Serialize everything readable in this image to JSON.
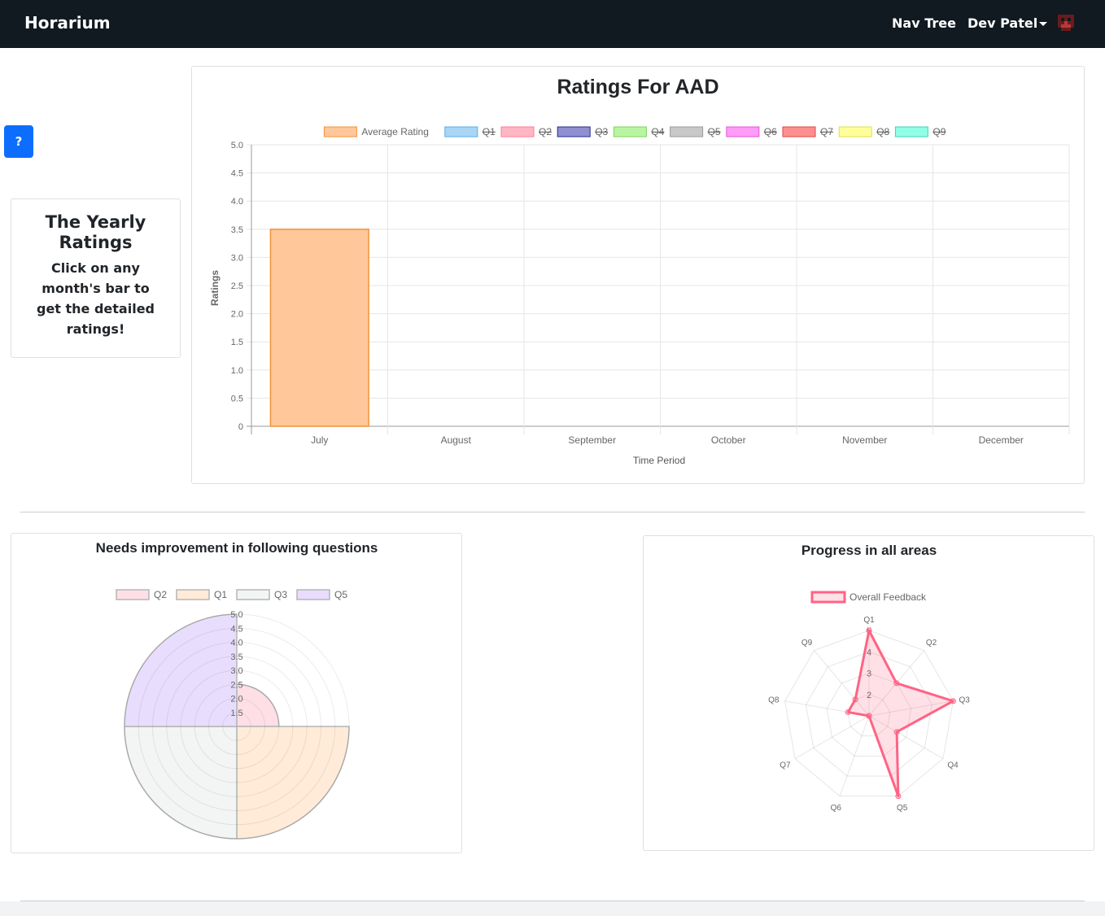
{
  "app": {
    "brand": "Horarium"
  },
  "nav": {
    "nav_tree": "Nav Tree",
    "user_name": "Dev Patel"
  },
  "help_button": "?",
  "yearly": {
    "title": "The Yearly Ratings",
    "text": "Click on any month's bar to get the detailed ratings!"
  },
  "bar_chart": {
    "title": "Ratings For AAD",
    "legend": [
      {
        "label": "Average Rating",
        "color": "#ffc79a",
        "border": "#f0933a",
        "hidden": false
      },
      {
        "label": "Q1",
        "color": "#a9d6f7",
        "border": "#5aa9e6",
        "hidden": true
      },
      {
        "label": "Q2",
        "color": "#ffb6c5",
        "border": "#ff7c98",
        "hidden": true
      },
      {
        "label": "Q3",
        "color": "#8f8fd1",
        "border": "#2b2b8e",
        "hidden": true
      },
      {
        "label": "Q4",
        "color": "#b8f5a1",
        "border": "#7cd35a",
        "hidden": true
      },
      {
        "label": "Q5",
        "color": "#c8c8c8",
        "border": "#9a9a9a",
        "hidden": true
      },
      {
        "label": "Q6",
        "color": "#ff9cf7",
        "border": "#e255d8",
        "hidden": true
      },
      {
        "label": "Q7",
        "color": "#ff8f8f",
        "border": "#e04545",
        "hidden": true
      },
      {
        "label": "Q8",
        "color": "#ffff9a",
        "border": "#dede55",
        "hidden": true
      },
      {
        "label": "Q9",
        "color": "#8fffe6",
        "border": "#3ed6b3",
        "hidden": true
      }
    ]
  },
  "polar": {
    "title": "Needs improvement in following questions",
    "legend": [
      {
        "label": "Q2",
        "color": "#ffdfe6"
      },
      {
        "label": "Q1",
        "color": "#ffebd8"
      },
      {
        "label": "Q3",
        "color": "#f3f4f4"
      },
      {
        "label": "Q5",
        "color": "#e9ddfd"
      }
    ]
  },
  "radar": {
    "title": "Progress in all areas",
    "legend": [
      {
        "label": "Overall Feedback",
        "color": "#ff6384"
      }
    ]
  },
  "chart_data": [
    {
      "type": "bar",
      "title": "Ratings For AAD",
      "xlabel": "Time Period",
      "ylabel": "Ratings",
      "categories": [
        "July",
        "August",
        "September",
        "October",
        "November",
        "December"
      ],
      "series": [
        {
          "name": "Average Rating",
          "values": [
            3.5,
            null,
            null,
            null,
            null,
            null
          ]
        }
      ],
      "ylim": [
        0,
        5
      ],
      "yticks": [
        "0",
        "0.5",
        "1.0",
        "1.5",
        "2.0",
        "2.5",
        "3.0",
        "3.5",
        "4.0",
        "4.5",
        "5.0"
      ],
      "grid": true,
      "legend_position": "top"
    },
    {
      "type": "polar-area",
      "title": "Needs improvement in following questions",
      "categories": [
        "Q2",
        "Q1",
        "Q3",
        "Q5"
      ],
      "values": [
        2.5,
        5,
        5,
        5
      ],
      "rlim": [
        1,
        5
      ],
      "rticks": [
        "1.5",
        "2.0",
        "2.5",
        "3.0",
        "3.5",
        "4.0",
        "4.5",
        "5.0"
      ],
      "legend_position": "top"
    },
    {
      "type": "radar",
      "title": "Progress in all areas",
      "categories": [
        "Q1",
        "Q2",
        "Q3",
        "Q4",
        "Q5",
        "Q6",
        "Q7",
        "Q8",
        "Q9"
      ],
      "series": [
        {
          "name": "Overall Feedback",
          "values": [
            5,
            3,
            5,
            2.5,
            5,
            1,
            1,
            2,
            2
          ]
        }
      ],
      "rlim": [
        1,
        5
      ],
      "rticks": [
        "2",
        "3",
        "4",
        "5"
      ],
      "legend_position": "top"
    }
  ]
}
